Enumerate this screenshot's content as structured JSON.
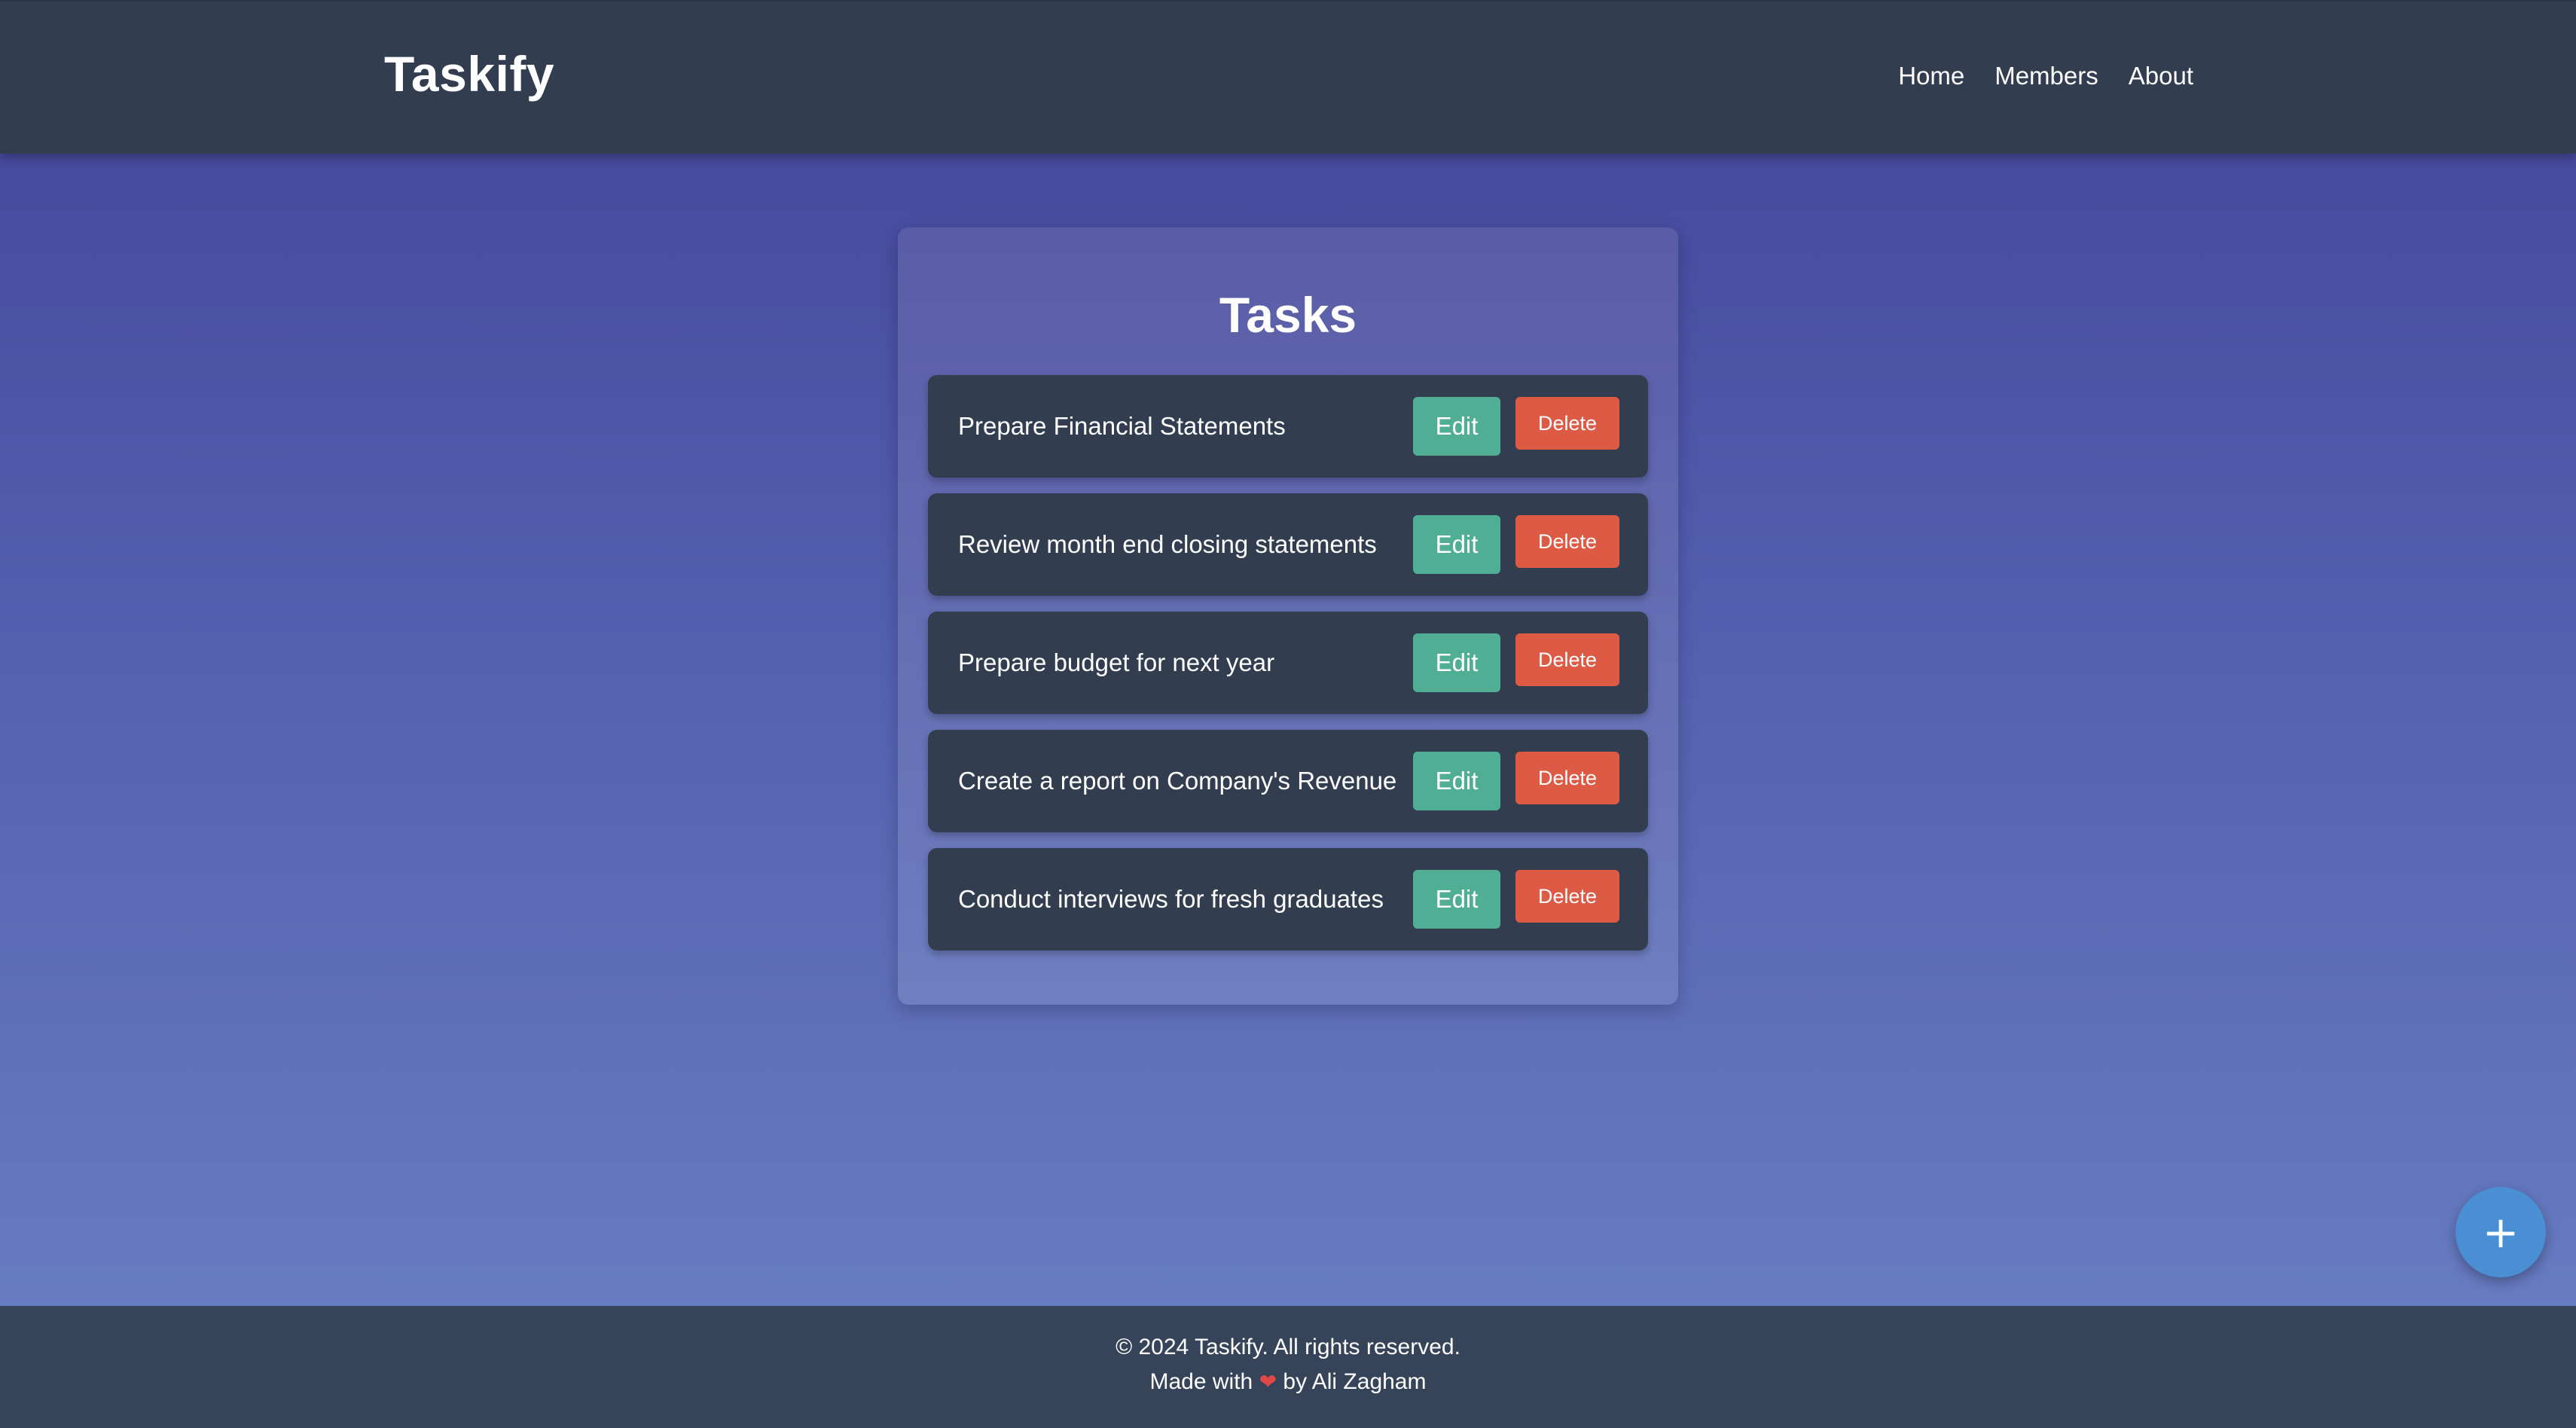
{
  "header": {
    "brand": "Taskify",
    "nav": [
      {
        "label": "Home"
      },
      {
        "label": "Members"
      },
      {
        "label": "About"
      }
    ]
  },
  "main": {
    "title": "Tasks",
    "tasks": [
      {
        "text": "Prepare Financial Statements",
        "edit_label": "Edit",
        "delete_label": "Delete"
      },
      {
        "text": "Review month end closing statements",
        "edit_label": "Edit",
        "delete_label": "Delete"
      },
      {
        "text": "Prepare budget for next year",
        "edit_label": "Edit",
        "delete_label": "Delete"
      },
      {
        "text": "Create a report on Company's Revenue",
        "edit_label": "Edit",
        "delete_label": "Delete"
      },
      {
        "text": "Conduct interviews for fresh graduates",
        "edit_label": "Edit",
        "delete_label": "Delete"
      }
    ]
  },
  "fab": {
    "label": "+",
    "icon": "plus-icon"
  },
  "footer": {
    "copyright": "© 2024 Taskify. All rights reserved.",
    "made_with_prefix": "Made with",
    "heart": "❤",
    "made_with_suffix": "by Ali Zagham"
  },
  "colors": {
    "header_bg": "#323e50",
    "edit_button": "#4fae93",
    "delete_button": "#dd5a45",
    "fab": "#4a8fd4",
    "footer_bg": "#364459"
  }
}
